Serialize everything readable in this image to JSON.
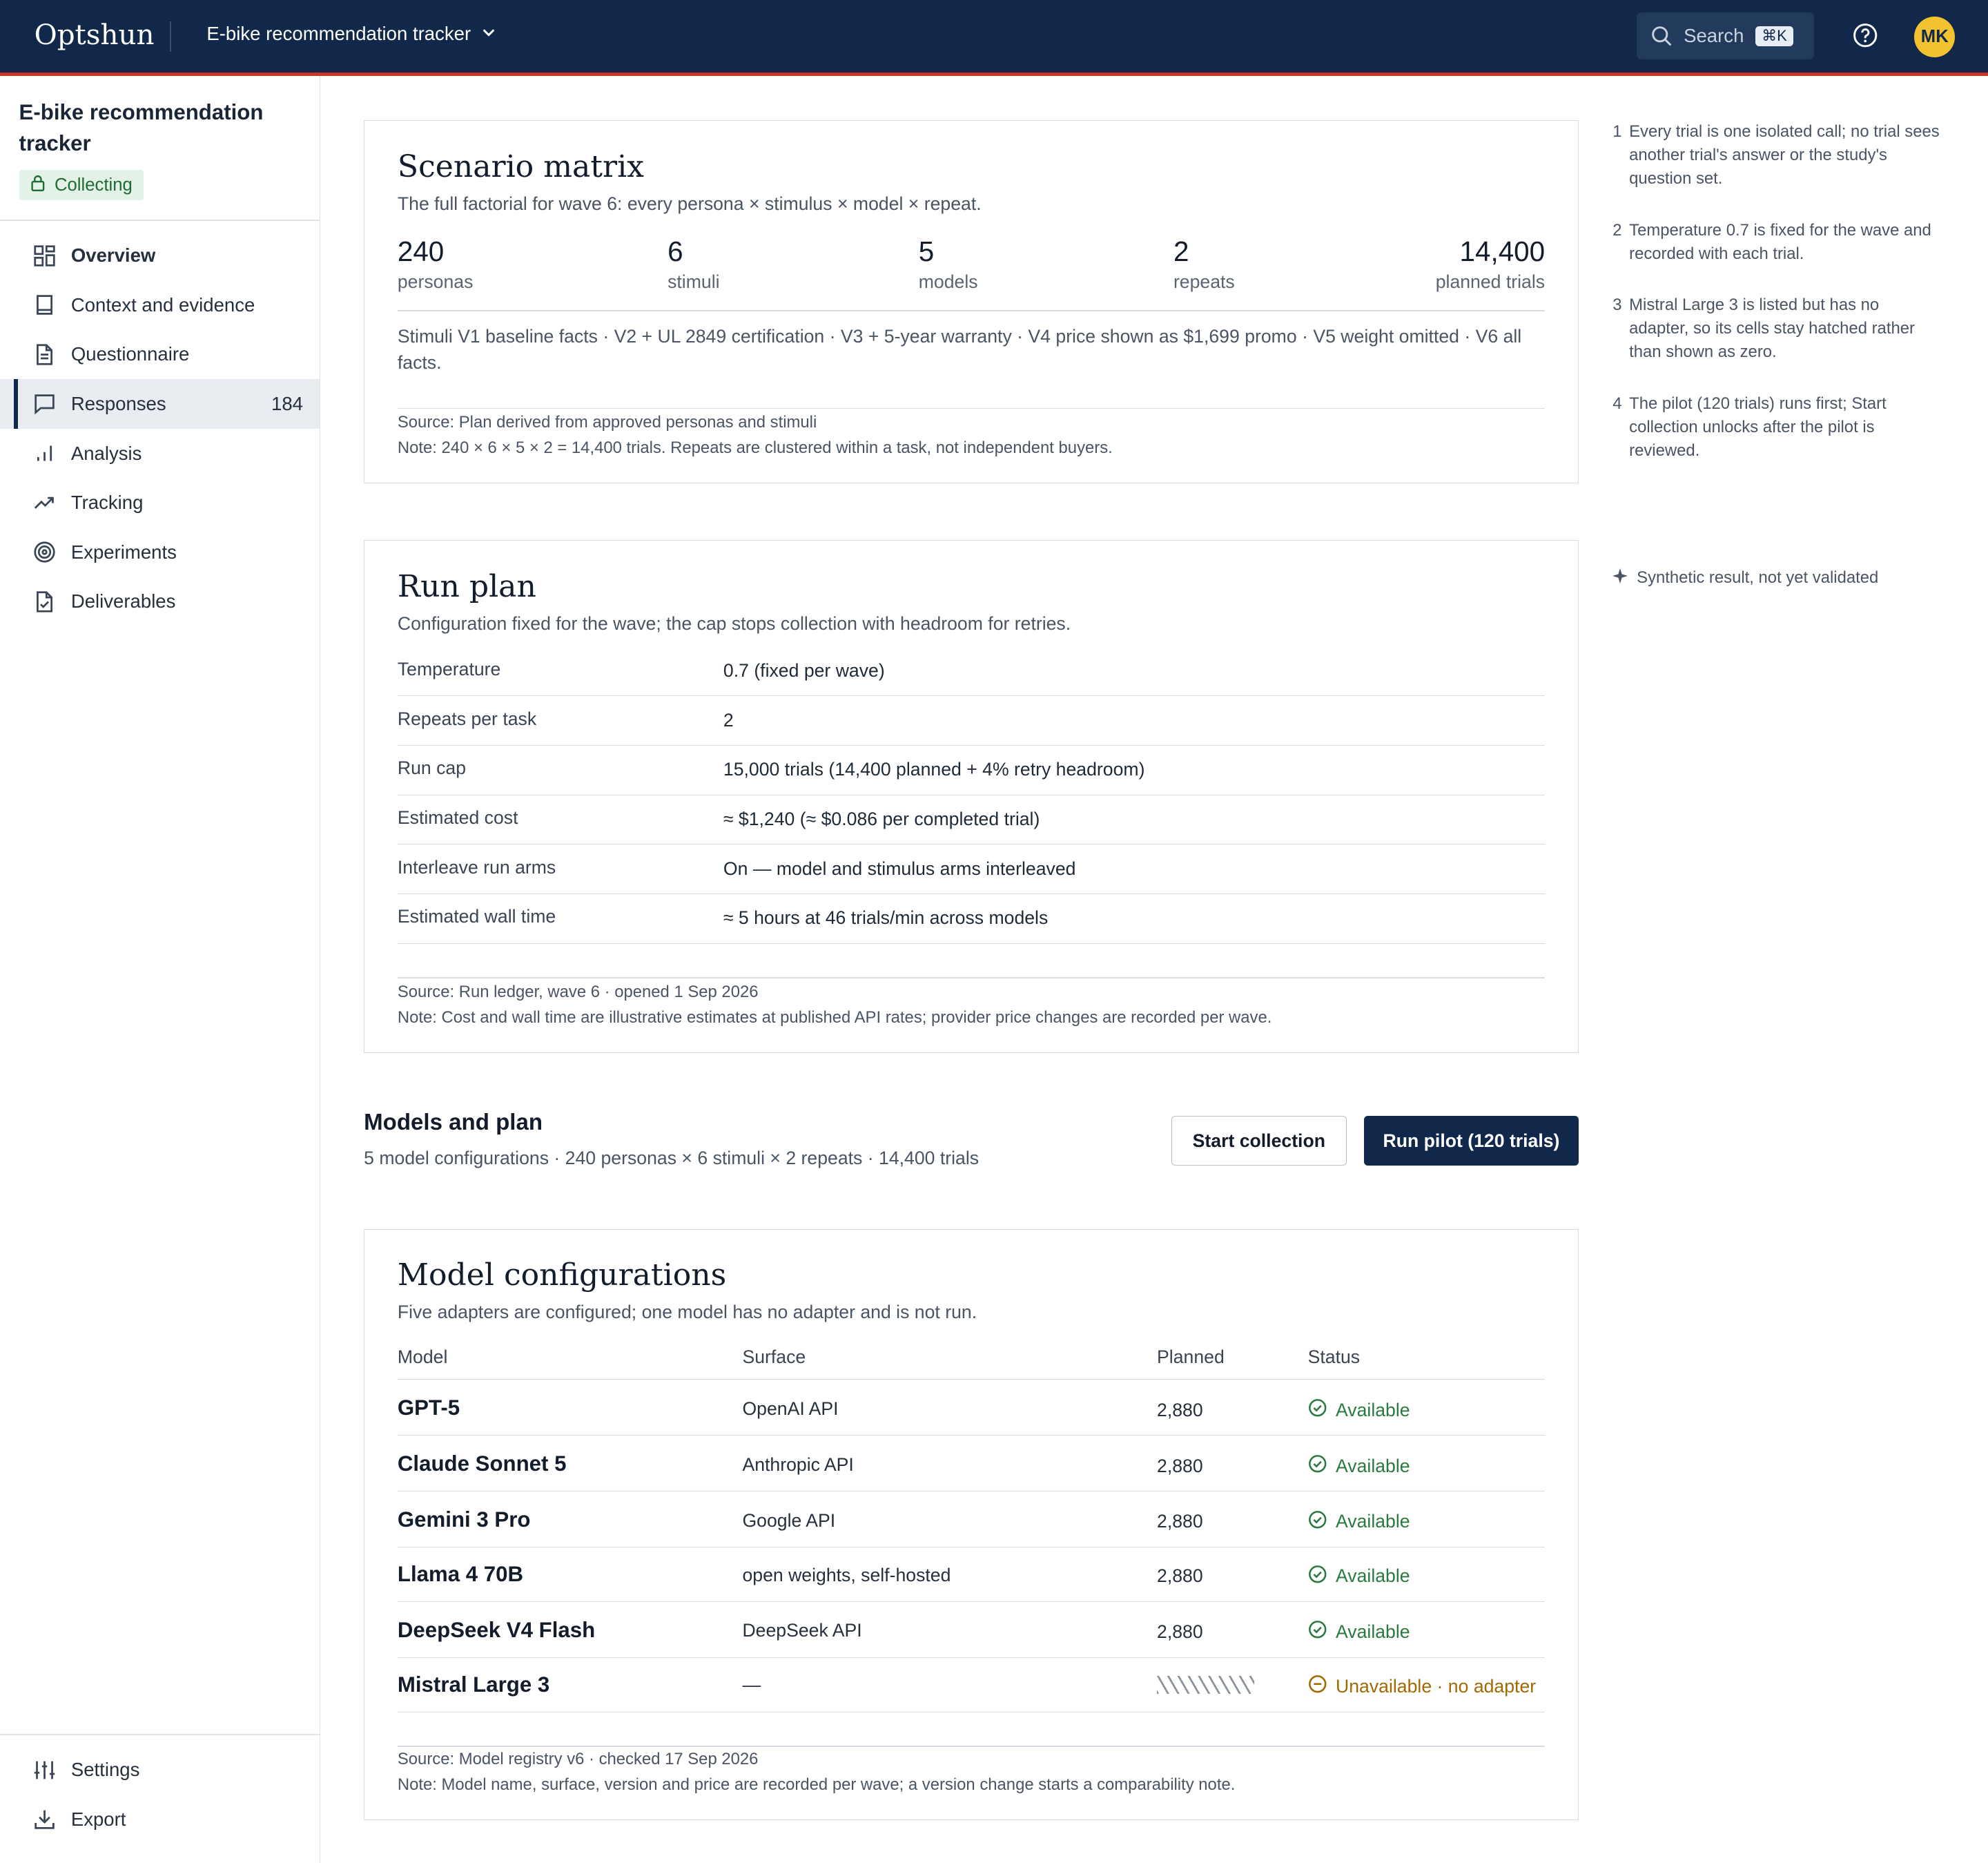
{
  "topbar": {
    "brand": "Optshun",
    "project": "E-bike recommendation tracker",
    "search_label": "Search",
    "search_shortcut": "⌘K",
    "avatar_initials": "MK"
  },
  "sidebar": {
    "project_title": "E-bike recommendation tracker",
    "status": "Collecting",
    "items": [
      {
        "label": "Overview",
        "icon": "grid-icon"
      },
      {
        "label": "Context and evidence",
        "icon": "book-icon"
      },
      {
        "label": "Questionnaire",
        "icon": "document-icon"
      },
      {
        "label": "Responses",
        "icon": "chat-icon",
        "count": "184"
      },
      {
        "label": "Analysis",
        "icon": "bar-chart-icon"
      },
      {
        "label": "Tracking",
        "icon": "trend-icon"
      },
      {
        "label": "Experiments",
        "icon": "target-icon"
      },
      {
        "label": "Deliverables",
        "icon": "checked-document-icon"
      }
    ],
    "bottom_items": [
      {
        "label": "Settings",
        "icon": "sliders-icon"
      },
      {
        "label": "Export",
        "icon": "download-icon"
      }
    ]
  },
  "scenario": {
    "title": "Scenario matrix",
    "subtitle": "The full factorial for wave 6: every persona × stimulus × model × repeat.",
    "stats": [
      {
        "value": "240",
        "label": "personas"
      },
      {
        "value": "6",
        "label": "stimuli"
      },
      {
        "value": "5",
        "label": "models"
      },
      {
        "value": "2",
        "label": "repeats"
      },
      {
        "value": "14,400",
        "label": "planned trials"
      }
    ],
    "stimuli": "Stimuli V1 baseline facts · V2 + UL 2849 certification · V3 + 5-year warranty · V4 price shown as $1,699 promo · V5 weight omitted · V6 all facts.",
    "source": "Source: Plan derived from approved personas and stimuli",
    "note": "Note: 240 × 6 × 5 × 2 = 14,400 trials. Repeats are clustered within a task, not independent buyers."
  },
  "runplan": {
    "title": "Run plan",
    "subtitle": "Configuration fixed for the wave; the cap stops collection with headroom for retries.",
    "rows": [
      {
        "key": "Temperature",
        "value": "0.7 (fixed per wave)"
      },
      {
        "key": "Repeats per task",
        "value": "2"
      },
      {
        "key": "Run cap",
        "value": "15,000 trials (14,400 planned + 4% retry headroom)"
      },
      {
        "key": "Estimated cost",
        "value": "≈ $1,240 (≈ $0.086 per completed trial)"
      },
      {
        "key": "Interleave run arms",
        "value": "On — model and stimulus arms interleaved"
      },
      {
        "key": "Estimated wall time",
        "value": "≈ 5 hours at 46 trials/min across models"
      }
    ],
    "source": "Source: Run ledger, wave 6 · opened 1 Sep 2026",
    "note": "Note: Cost and wall time are illustrative estimates at published API rates; provider price changes are recorded per wave."
  },
  "models_plan": {
    "title": "Models and plan",
    "subtitle": "5 model configurations · 240 personas × 6 stimuli × 2 repeats · 14,400 trials",
    "start_button": "Start collection",
    "pilot_button": "Run pilot (120 trials)"
  },
  "model_configs": {
    "title": "Model configurations",
    "subtitle": "Five adapters are configured; one model has no adapter and is not run.",
    "headers": {
      "model": "Model",
      "surface": "Surface",
      "planned": "Planned",
      "status": "Status"
    },
    "rows": [
      {
        "model": "GPT-5",
        "surface": "OpenAI API",
        "planned": "2,880",
        "status": "Available",
        "ok": true
      },
      {
        "model": "Claude Sonnet 5",
        "surface": "Anthropic API",
        "planned": "2,880",
        "status": "Available",
        "ok": true
      },
      {
        "model": "Gemini 3 Pro",
        "surface": "Google API",
        "planned": "2,880",
        "status": "Available",
        "ok": true
      },
      {
        "model": "Llama 4 70B",
        "surface": "open weights, self-hosted",
        "planned": "2,880",
        "status": "Available",
        "ok": true
      },
      {
        "model": "DeepSeek V4 Flash",
        "surface": "DeepSeek API",
        "planned": "2,880",
        "status": "Available",
        "ok": true
      },
      {
        "model": "Mistral Large 3",
        "surface": "—",
        "planned": "",
        "status": "Unavailable · no adapter",
        "ok": false
      }
    ],
    "source": "Source: Model registry v6 · checked 17 Sep 2026",
    "note": "Note: Model name, surface, version and price are recorded per wave; a version change starts a comparability note."
  },
  "margin_notes": [
    {
      "n": "1",
      "text": "Every trial is one isolated call; no trial sees another trial's answer or the study's question set."
    },
    {
      "n": "2",
      "text": "Temperature 0.7 is fixed for the wave and recorded with each trial."
    },
    {
      "n": "3",
      "text": "Mistral Large 3 is listed but has no adapter, so its cells stay hatched rather than shown as zero."
    },
    {
      "n": "4",
      "text": "The pilot (120 trials) runs first; Start collection unlocks after the pilot is reviewed."
    }
  ],
  "synthetic_label": "Synthetic result, not yet validated",
  "colors": {
    "navy": "#12284a",
    "accent_red": "#c8372f",
    "ok_green": "#2a7a3f",
    "warn_amber": "#a06a00",
    "avatar": "#f2c230"
  }
}
